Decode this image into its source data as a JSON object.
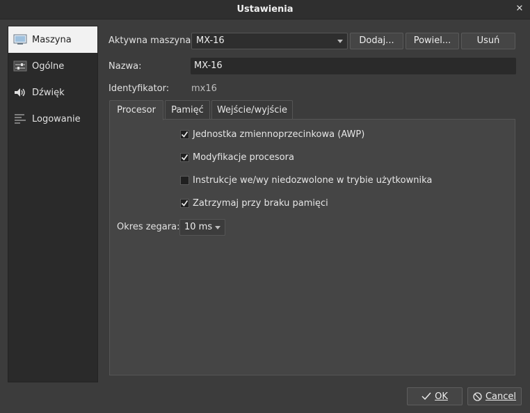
{
  "window": {
    "title": "Ustawienia",
    "close_glyph": "✕"
  },
  "sidebar": {
    "items": [
      {
        "label": "Maszyna",
        "icon": "monitor-icon",
        "active": true
      },
      {
        "label": "Ogólne",
        "icon": "sliders-icon",
        "active": false
      },
      {
        "label": "Dźwięk",
        "icon": "speaker-icon",
        "active": false
      },
      {
        "label": "Logowanie",
        "icon": "log-lines-icon",
        "active": false
      }
    ]
  },
  "machine": {
    "active_label": "Aktywna maszyna:",
    "active_value": "MX-16",
    "add_label": "Dodaj...",
    "duplicate_label": "Powiel...",
    "remove_label": "Usuń",
    "name_label": "Nazwa:",
    "name_value": "MX-16",
    "id_label": "Identyfikator:",
    "id_value": "mx16"
  },
  "tabs": [
    {
      "label": "Procesor",
      "active": true
    },
    {
      "label": "Pamięć",
      "active": false
    },
    {
      "label": "Wejście/wyjście",
      "active": false
    }
  ],
  "processor": {
    "options": [
      {
        "label": "Jednostka zmiennoprzecinkowa (AWP)",
        "checked": true
      },
      {
        "label": "Modyfikacje procesora",
        "checked": true
      },
      {
        "label": "Instrukcje we/wy niedozwolone w trybie użytkownika",
        "checked": false
      },
      {
        "label": "Zatrzymaj przy braku pamięci",
        "checked": true
      }
    ],
    "clock_label": "Okres zegara:",
    "clock_value": "10 ms"
  },
  "footer": {
    "ok_label": "OK",
    "cancel_label": "Cancel"
  },
  "colors": {
    "accent": "#f2f2f2",
    "background": "#3c3c3c",
    "panel": "#454545"
  }
}
